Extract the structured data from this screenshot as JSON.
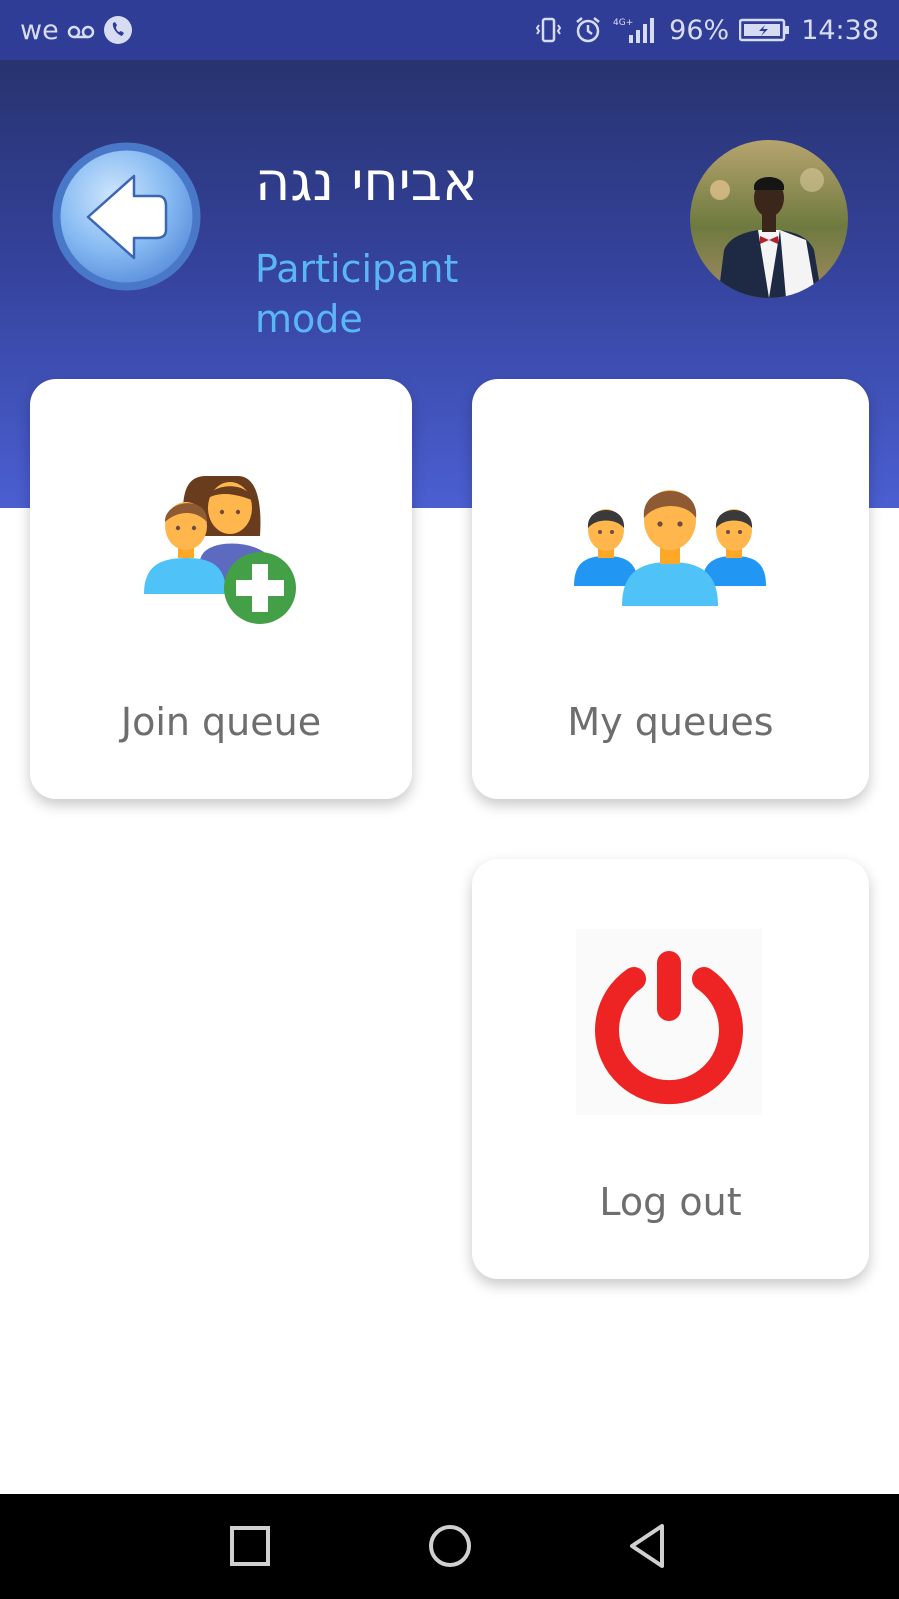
{
  "status_bar": {
    "carrier": "we",
    "battery": "96%",
    "time": "14:38",
    "network": "4G+"
  },
  "header": {
    "user_name": "אביחי נגה",
    "mode": "Participant mode",
    "colors": {
      "mode_text": "#5bb6f5",
      "gradient_top": "#28336f",
      "gradient_bottom": "#4b5fd1"
    }
  },
  "tiles": {
    "join_queue": {
      "label": "Join queue",
      "icon": "add-people-icon"
    },
    "my_queues": {
      "label": "My queues",
      "icon": "group-icon"
    },
    "log_out": {
      "label": "Log out",
      "icon": "power-icon"
    }
  },
  "nav": {
    "recent": "recent-apps-icon",
    "home": "home-icon",
    "back": "back-triangle-icon"
  }
}
